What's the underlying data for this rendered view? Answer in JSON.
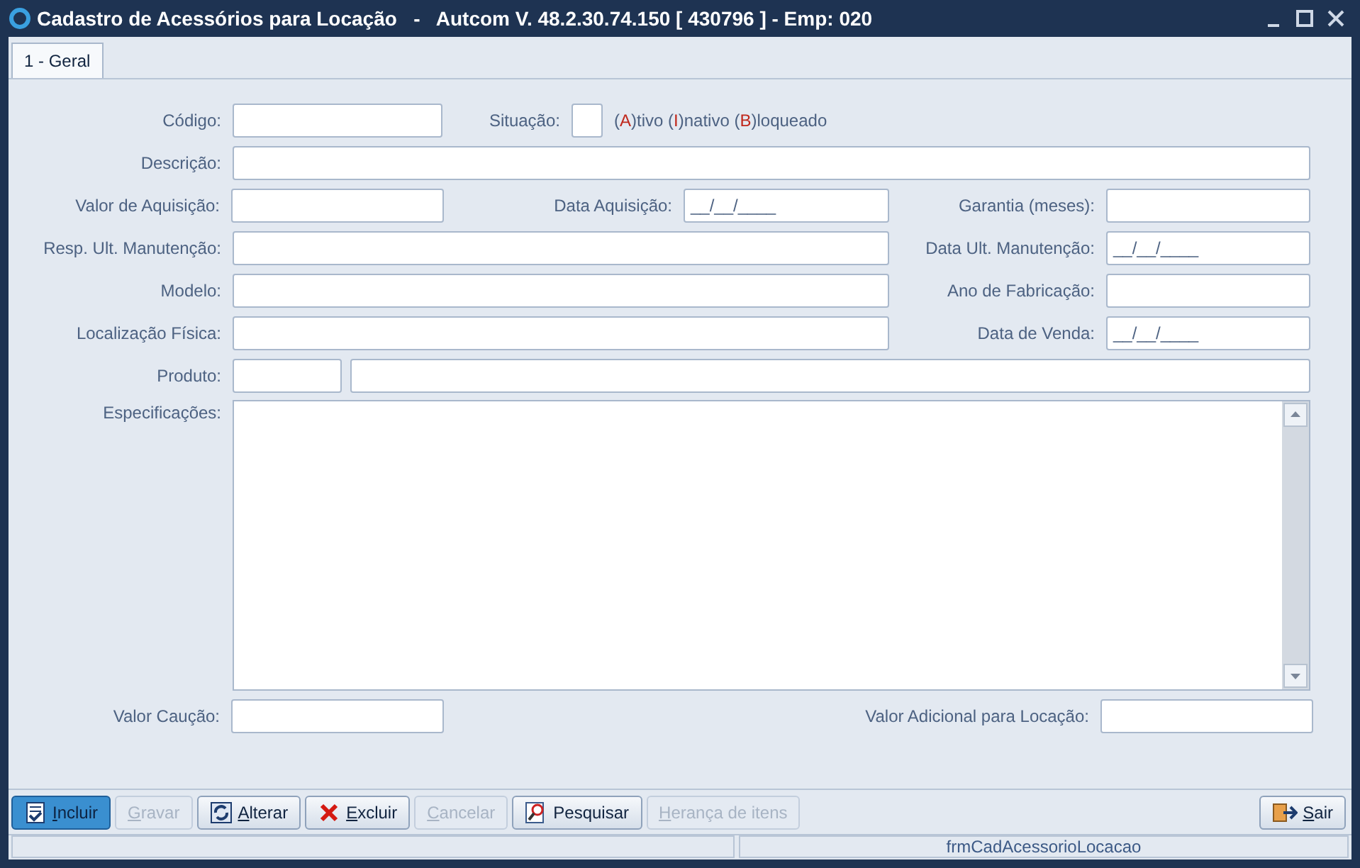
{
  "window": {
    "title": "Cadastro de Acessórios para Locação   -   Autcom V. 48.2.30.74.150 [ 430796 ] - Emp: 020"
  },
  "tabs": [
    {
      "label": "1 - Geral",
      "selected": true
    }
  ],
  "form": {
    "codigo": {
      "label": "Código:"
    },
    "situacao": {
      "label": "Situação:",
      "legend": [
        {
          "pre": "(",
          "key": "A",
          "post": ")tivo "
        },
        {
          "pre": "(",
          "key": "I",
          "post": ")nativo "
        },
        {
          "pre": "(",
          "key": "B",
          "post": ")loqueado"
        }
      ]
    },
    "descricao": {
      "label": "Descrição:"
    },
    "valor_aquisicao": {
      "label": "Valor de Aquisição:"
    },
    "data_aquisicao": {
      "label": "Data Aquisição:",
      "value": "__/__/____"
    },
    "garantia": {
      "label": "Garantia (meses):"
    },
    "resp_manutencao": {
      "label": "Resp. Ult. Manutenção:"
    },
    "data_manutencao": {
      "label": "Data Ult. Manutenção:",
      "value": "__/__/____"
    },
    "modelo": {
      "label": "Modelo:"
    },
    "ano_fabricacao": {
      "label": "Ano de Fabricação:"
    },
    "localizacao": {
      "label": "Localização Física:"
    },
    "data_venda": {
      "label": "Data de Venda:",
      "value": "__/__/____"
    },
    "produto": {
      "label": "Produto:"
    },
    "especificacoes": {
      "label": "Especificações:"
    },
    "valor_caucao": {
      "label": "Valor Caução:"
    },
    "valor_adicional": {
      "label": "Valor Adicional para Locação:"
    }
  },
  "toolbar": [
    {
      "label": "Incluir",
      "kind": "doc-check",
      "underline_first": true,
      "selected": true,
      "disabled": false
    },
    {
      "label": "Gravar",
      "kind": "plain",
      "underline_first": true,
      "selected": false,
      "disabled": true
    },
    {
      "label": "Alterar",
      "kind": "refresh",
      "underline_first": true,
      "selected": false,
      "disabled": false
    },
    {
      "label": "Excluir",
      "kind": "delete",
      "underline_first": true,
      "selected": false,
      "disabled": false
    },
    {
      "label": "Cancelar",
      "kind": "plain",
      "underline_first": true,
      "selected": false,
      "disabled": true
    },
    {
      "label": "Pesquisar",
      "kind": "search",
      "underline_first": false,
      "selected": false,
      "disabled": false
    },
    {
      "label": "Herança de itens",
      "kind": "plain",
      "underline_first": true,
      "selected": false,
      "disabled": true
    },
    {
      "label": "Sair",
      "kind": "exit",
      "underline_first": true,
      "selected": false,
      "disabled": false
    }
  ],
  "status_bar": {
    "panel_2": "frmCadAcessorioLocacao"
  }
}
